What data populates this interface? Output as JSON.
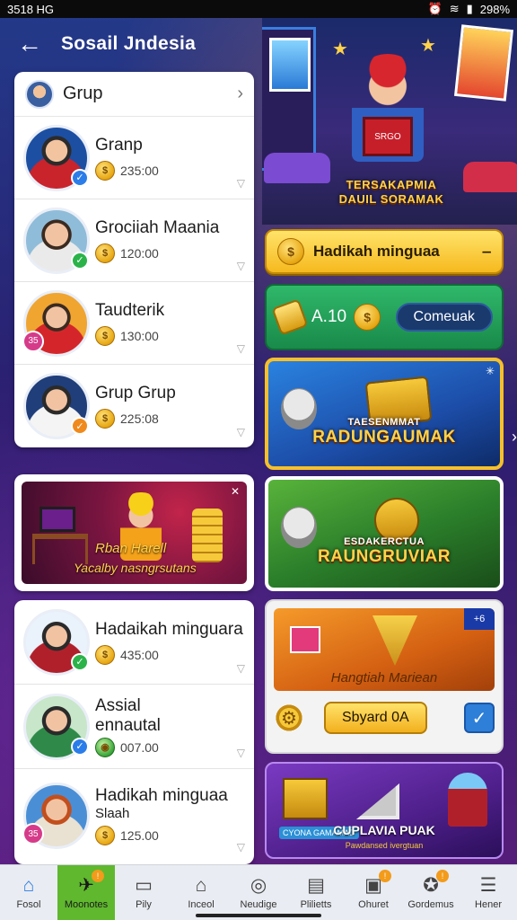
{
  "status_bar": {
    "left": "3518 HG",
    "battery": "298%"
  },
  "header": {
    "title": "Sosail Jndesia"
  },
  "group": {
    "title": "Grup"
  },
  "members_top": [
    {
      "name": "Granp",
      "amount": "235:00",
      "badge": "✓"
    },
    {
      "name": "Grociiah Maania",
      "amount": "120:00",
      "badge": "✓"
    },
    {
      "name": "Taudterik",
      "amount": "130:00",
      "badge": "35"
    },
    {
      "name": "Grup Grup",
      "amount": "225:08",
      "badge": "✓"
    }
  ],
  "banner_left": {
    "line1": "Rban Harell",
    "line2": "Yacalby nasngrsutans"
  },
  "members_bottom": [
    {
      "name": "Hadaikah minguara",
      "sub": "",
      "amount": "435:00",
      "badge": "✓"
    },
    {
      "name": "Assial",
      "sub": "ennautal",
      "amount": "007.00",
      "badge": "✓"
    },
    {
      "name": "Hadikah minguaa",
      "sub": "Slaah",
      "amount": "125.00",
      "badge": "35"
    }
  ],
  "hero": {
    "book": "SRGO",
    "caption_line1": "TERSAKAPMIA",
    "caption_line2": "DAUIL SORAMAK"
  },
  "weekly_pill": {
    "label": "Hadikah minguaa"
  },
  "green_bar": {
    "value": "A.10",
    "button": "Comeuak"
  },
  "promo1": {
    "small": "TAESENMMAT",
    "big": "RADUNGAUMAK"
  },
  "promo2": {
    "small": "ESDAKERCTUA",
    "big": "RAUNGRUVIAR"
  },
  "promo3": {
    "caption": "Hangtiah Mariean",
    "corner": "+6",
    "button": "Sbyard 0A"
  },
  "promo4": {
    "label": "CYONA GAMAMAD",
    "title": "CUPLAVIA PUAK",
    "sub": "Pawdansed ivergtuan"
  },
  "bottom_nav": [
    {
      "label": "Fosol",
      "icon": "home-icon",
      "glyph": "⌂"
    },
    {
      "label": "Moonotes",
      "icon": "rocket-icon",
      "glyph": "✈"
    },
    {
      "label": "Pily",
      "icon": "box-icon",
      "glyph": "▭"
    },
    {
      "label": "Inceol",
      "icon": "house-icon",
      "glyph": "⌂"
    },
    {
      "label": "Neudige",
      "icon": "compass-icon",
      "glyph": "◎"
    },
    {
      "label": "Plilietts",
      "icon": "document-icon",
      "glyph": "▤"
    },
    {
      "label": "Ohuret",
      "icon": "package-icon",
      "glyph": "▣"
    },
    {
      "label": "Gordemus",
      "icon": "trophy-icon",
      "glyph": "✪"
    },
    {
      "label": "Hener",
      "icon": "menu-icon",
      "glyph": "☰"
    }
  ],
  "colors": {
    "accent": "#f6b91e",
    "green": "#2fb86a",
    "nav_highlight": "#5fb82e"
  }
}
